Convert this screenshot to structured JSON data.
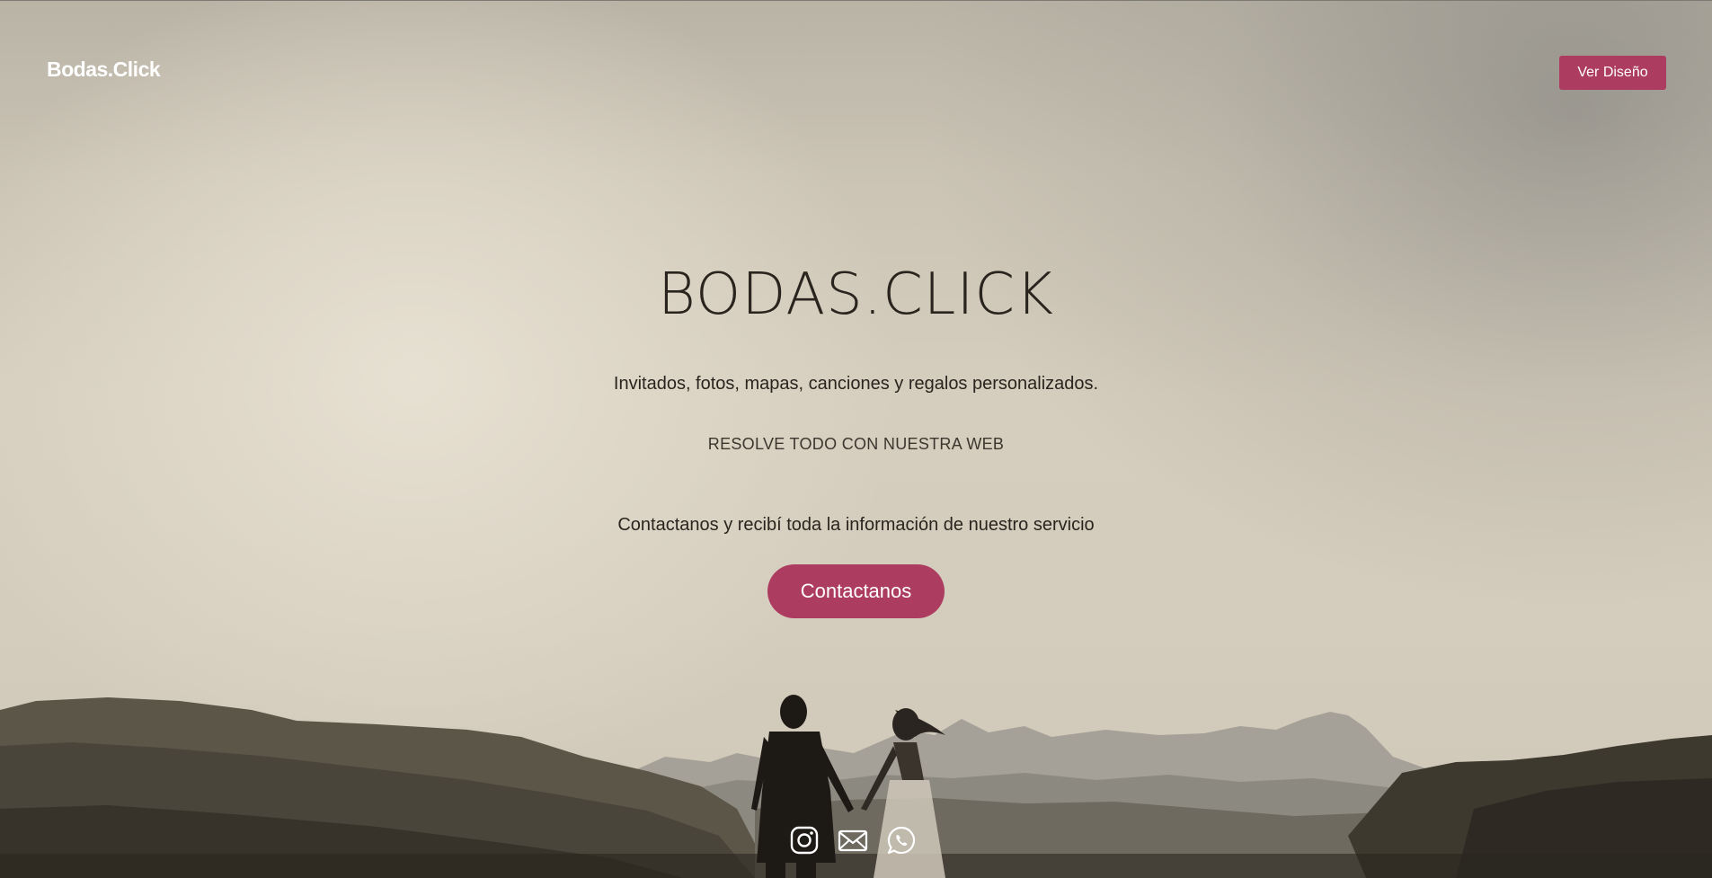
{
  "header": {
    "logo": "Bodas.Click",
    "cta_label": "Ver Diseño"
  },
  "hero": {
    "title": "BODAS.CLICK",
    "subtitle": "Invitados, fotos, mapas, canciones y regalos personalizados.",
    "tagline": "RESOLVE TODO CON NUESTRA WEB",
    "contact_text": "Contactanos y recibí toda la información de nuestro servicio",
    "contact_button_label": "Contactanos"
  },
  "social": {
    "icons": [
      "instagram-icon",
      "mail-icon",
      "whatsapp-icon"
    ]
  },
  "colors": {
    "accent": "#ad3c61",
    "text_dark": "#2a241e",
    "logo": "#ffffff"
  }
}
